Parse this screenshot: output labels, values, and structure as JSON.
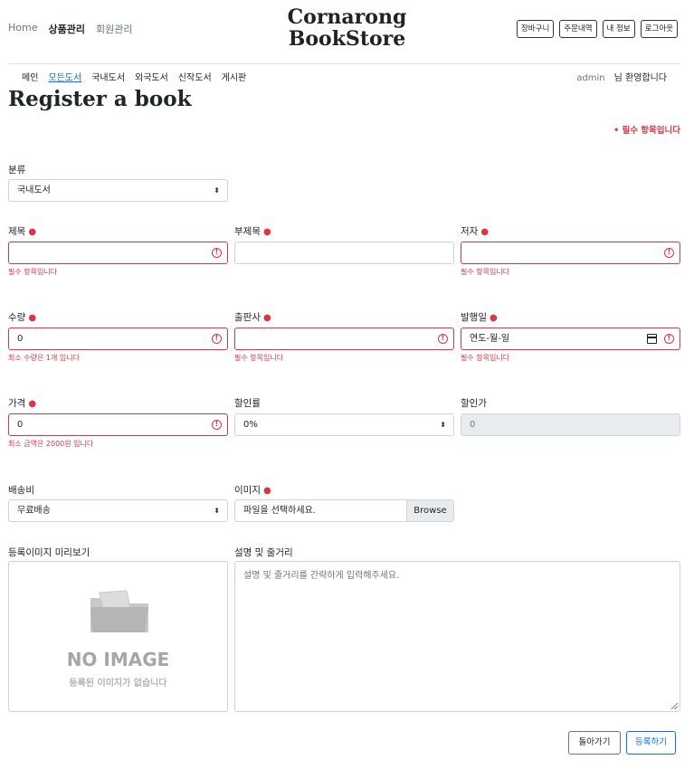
{
  "header": {
    "nav": [
      "Home",
      "상품관리",
      "회원관리"
    ],
    "active_nav": "상품관리",
    "brand_line1": "Cornarong",
    "brand_line2": "BookStore",
    "util_buttons": [
      "장바구니",
      "주문내역",
      "내 정보",
      "로그아웃"
    ]
  },
  "subnav": {
    "items": [
      "메인",
      "모든도서",
      "국내도서",
      "외국도서",
      "신작도서",
      "게시판"
    ],
    "active": "모든도서",
    "user": "admin",
    "welcome": "님 환영합니다"
  },
  "page": {
    "title": "Register a book",
    "required_note": "• 필수 항목입니다"
  },
  "form": {
    "category": {
      "label": "분류",
      "value": "국내도서"
    },
    "title": {
      "label": "제목",
      "value": "",
      "error": "필수 항목입니다"
    },
    "subtitle": {
      "label": "부제목",
      "value": ""
    },
    "author": {
      "label": "저자",
      "value": "",
      "error": "필수 항목입니다"
    },
    "quantity": {
      "label": "수량",
      "value": "0",
      "error": "최소 수량은 1개 입니다"
    },
    "publisher": {
      "label": "출판사",
      "value": "",
      "error": "필수 항목입니다"
    },
    "pubdate": {
      "label": "발행일",
      "value": "연도-월-일",
      "error": "필수 항목입니다"
    },
    "price": {
      "label": "가격",
      "value": "0",
      "error": "최소 금액은 2000원 입니다"
    },
    "discount_rate": {
      "label": "할인률",
      "value": "0%"
    },
    "discount_price": {
      "label": "할인가",
      "value": "0"
    },
    "shipping": {
      "label": "배송비",
      "value": "무료배송"
    },
    "image": {
      "label": "이미지",
      "placeholder": "파일을 선택하세요.",
      "browse": "Browse"
    },
    "preview": {
      "label": "등록이미지 미리보기",
      "no_image": "NO IMAGE",
      "no_image_sub": "등록된 이미지가 없습니다"
    },
    "description": {
      "label": "설명 및 줄거리",
      "placeholder": "설명 및 줄거리를 간략하게 입력해주세요."
    }
  },
  "actions": {
    "back": "돌아가기",
    "submit": "등록하기"
  },
  "colors": {
    "danger": "#dc3545",
    "primary": "#0d6efd",
    "border": "#ced4da",
    "disabled_bg": "#e9ecef"
  },
  "icons": [
    "error-circle-icon",
    "caret-updown-icon",
    "calendar-icon",
    "folder-icon",
    "resize-handle-icon"
  ]
}
